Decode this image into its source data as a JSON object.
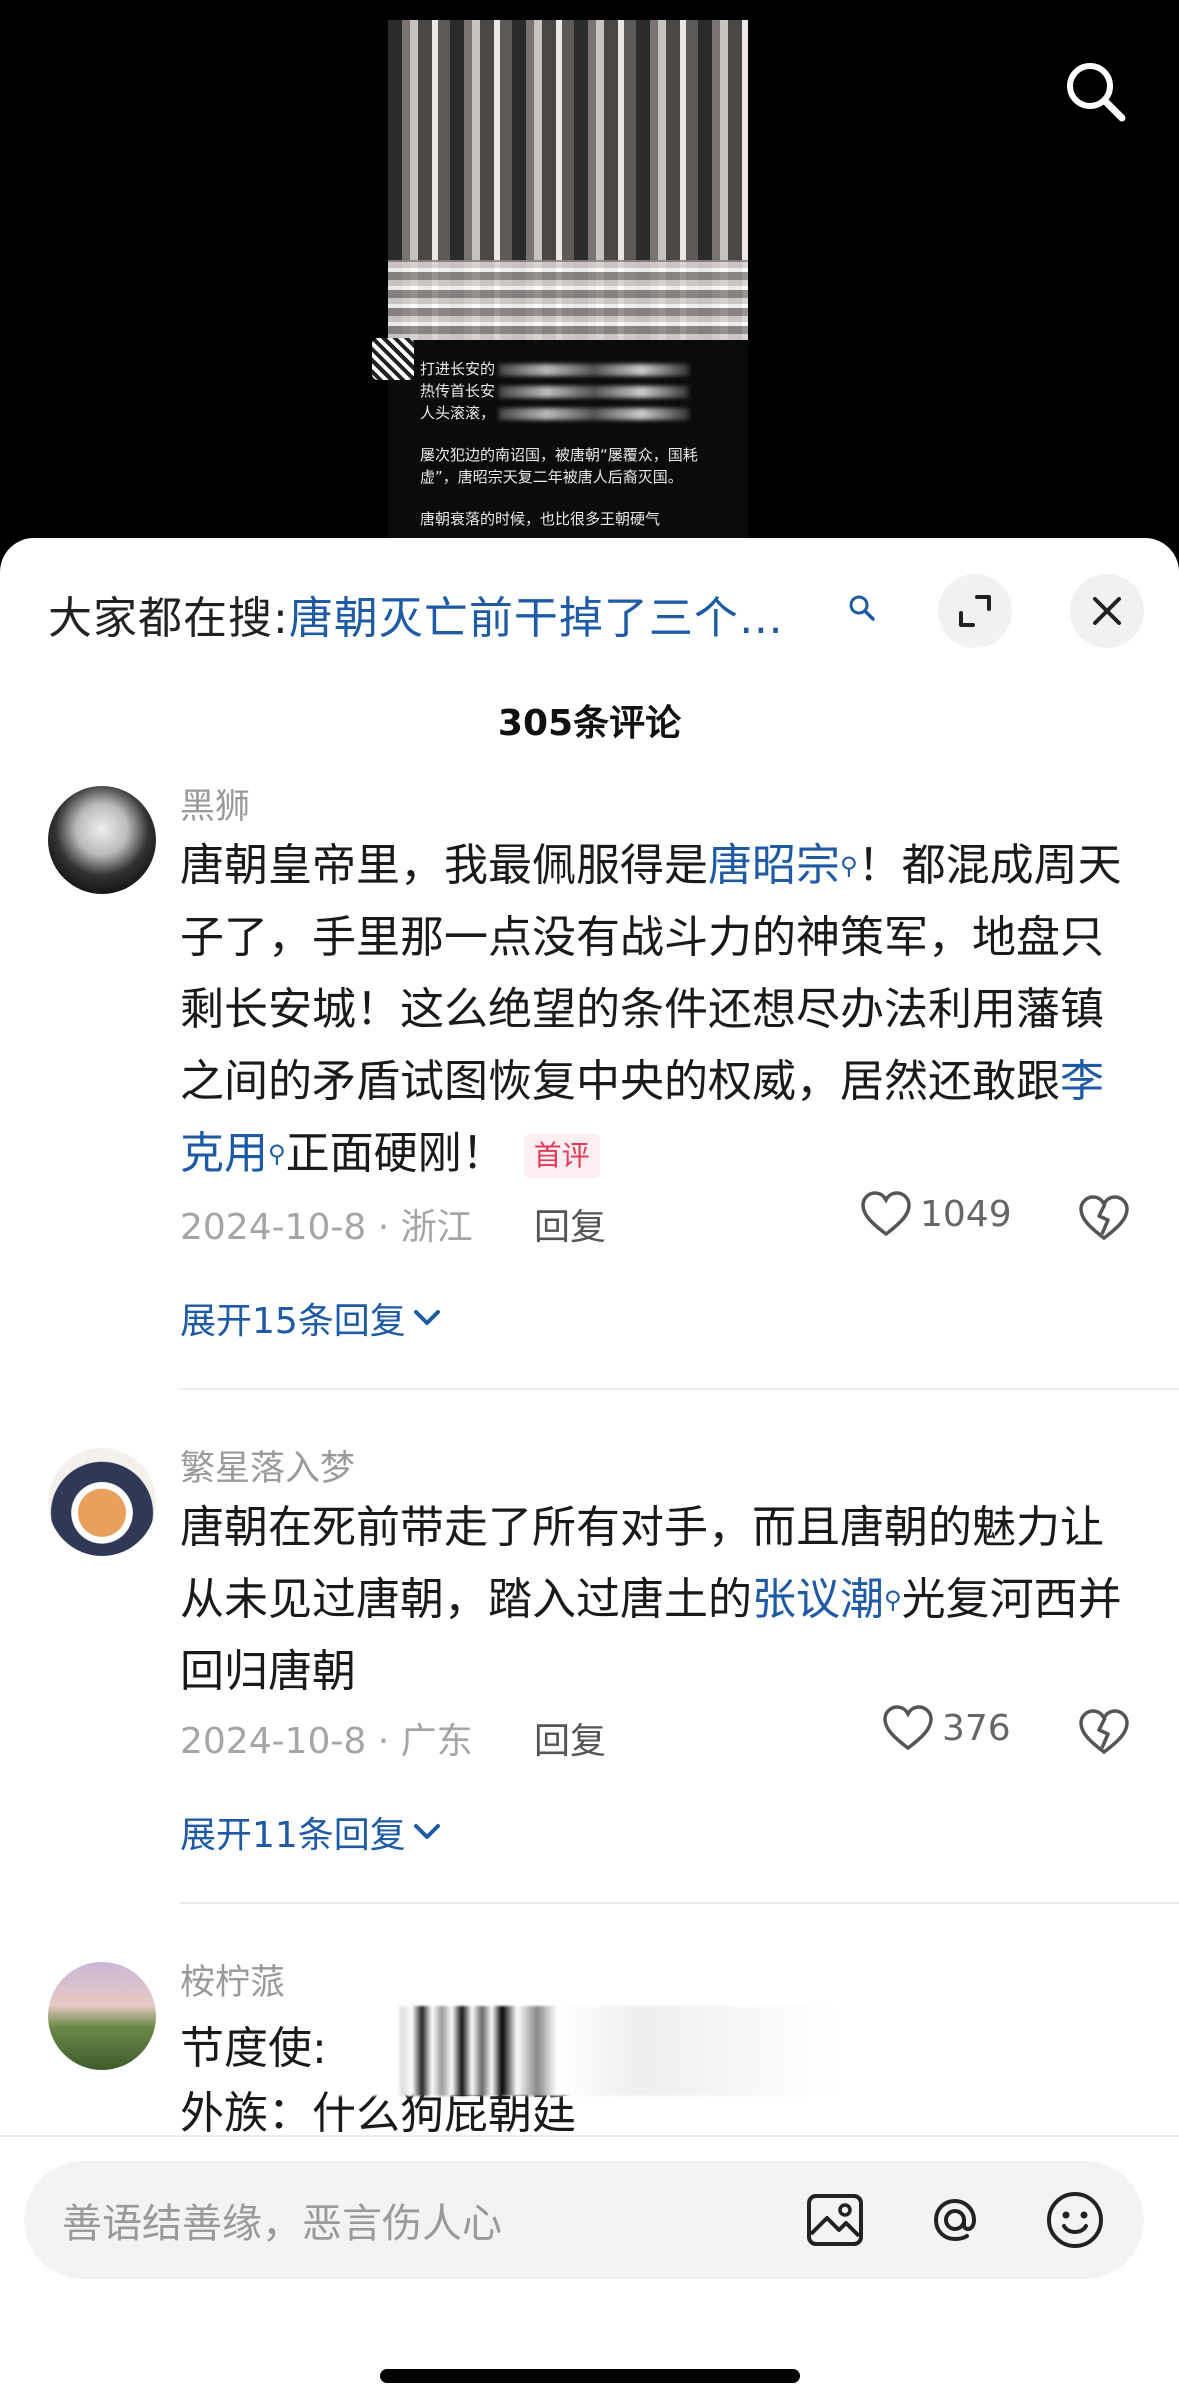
{
  "video": {
    "caption_lines": [
      "打进长安的",
      "热传首长安",
      "人头滚滚，",
      "屡次犯边的南诏国，被唐朝“屡覆众，国耗",
      "虚”，唐昭宗天复二年被唐人后裔灭国。",
      "唐朝衰落的时候，也比很多王朝硬气"
    ]
  },
  "header": {
    "hot_prefix": "大家都在搜:",
    "hot_topic": "唐朝灭亡前干掉了三个…",
    "comment_count": "305条评论"
  },
  "comments": [
    {
      "username": "黑狮",
      "text_1": "唐朝皇帝里，我最佩服得是",
      "link_1": "唐昭宗",
      "text_2": "！都混成周天子了，手里那一点没有战斗力的神策军，地盘只剩长安城！这么绝望的条件还想尽办法利用藩镇之间的矛盾试图恢复中央的权威，居然还敢跟",
      "link_2": "李克用",
      "text_3": "正面硬刚！",
      "badge": "首评",
      "date_loc": "2024-10-8 · 浙江",
      "reply": "回复",
      "likes": "1049",
      "expand": "展开15条回复"
    },
    {
      "username": "繁星落入梦",
      "text_1": "唐朝在死前带走了所有对手，而且唐朝的魅力让从未见过唐朝，踏入过唐土的",
      "link_1": "张议潮",
      "text_2": "光复河西并回归唐朝",
      "date_loc": "2024-10-8 · 广东",
      "reply": "回复",
      "likes": "376",
      "expand": "展开11条回复"
    },
    {
      "username": "桉柠蒎",
      "line_1": "节度使:",
      "line_2": "外族：什么狗屁朝廷"
    }
  ],
  "input": {
    "placeholder": "善语结善缘，恶言伤人心"
  },
  "colors": {
    "link": "#1f5aa5",
    "badge": "#e23a5b"
  }
}
